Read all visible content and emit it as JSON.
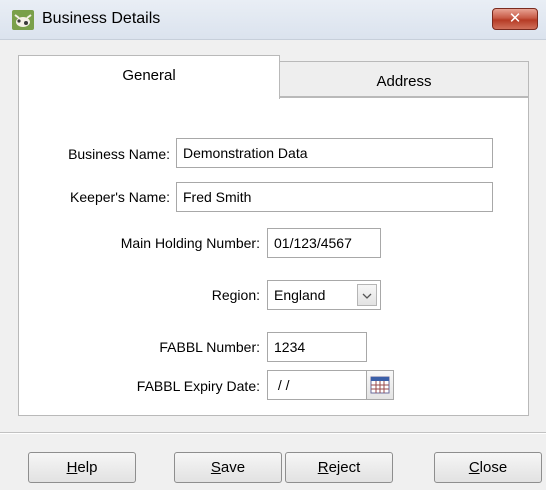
{
  "window": {
    "title": "Business Details",
    "icon": "cow-app-icon",
    "close_symbol": "✕"
  },
  "tabs": [
    {
      "label": "General",
      "active": true
    },
    {
      "label": "Address",
      "active": false
    }
  ],
  "form": {
    "business_name": {
      "label": "Business Name:",
      "value": "Demonstration Data"
    },
    "keeper_name": {
      "label": "Keeper's Name:",
      "value": "Fred Smith"
    },
    "main_holding_number": {
      "label": "Main Holding Number:",
      "value": "01/123/4567"
    },
    "region": {
      "label": "Region:",
      "value": "England"
    },
    "fabbl_number": {
      "label": "FABBL Number:",
      "value": "1234"
    },
    "fabbl_expiry_date": {
      "label": "FABBL Expiry Date:",
      "value": " / /"
    }
  },
  "buttons": {
    "help": {
      "first": "H",
      "rest": "elp"
    },
    "save": {
      "first": "S",
      "rest": "ave"
    },
    "reject": {
      "first": "R",
      "rest": "eject"
    },
    "close": {
      "first": "C",
      "rest": "lose"
    }
  },
  "colors": {
    "close_button": "#c75a45",
    "panel_background": "#ffffff",
    "window_background": "#f0f0f0"
  }
}
